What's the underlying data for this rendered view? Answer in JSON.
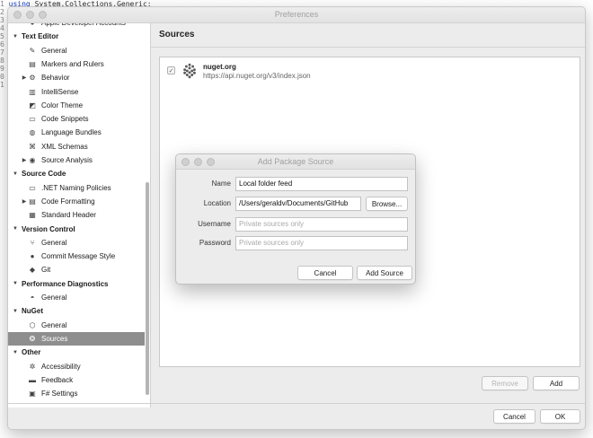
{
  "editor": {
    "lines": [
      {
        "num": "1",
        "kw": "using",
        "text": " System.Collections.Generic;"
      },
      {
        "num": "2",
        "kw": "",
        "text": ""
      },
      {
        "num": "3",
        "kw": "",
        "text": ""
      },
      {
        "num": "4",
        "kw": "",
        "text": ""
      },
      {
        "num": "5",
        "kw": "",
        "text": ""
      },
      {
        "num": "6",
        "kw": "",
        "text": ""
      },
      {
        "num": "7",
        "kw": "",
        "text": ""
      },
      {
        "num": "8",
        "kw": "",
        "text": ""
      },
      {
        "num": "9",
        "kw": "",
        "text": ""
      },
      {
        "num": "0",
        "kw": "",
        "text": ""
      },
      {
        "num": "1",
        "kw": "",
        "text": ""
      }
    ]
  },
  "window": {
    "title": "Preferences"
  },
  "sidebar": {
    "items": [
      {
        "label": "Apple Developer Accounts",
        "type": "item",
        "icon": "person-icon",
        "glyph": "●",
        "tri": ""
      },
      {
        "label": "Text Editor",
        "type": "cat",
        "icon": "",
        "glyph": "",
        "tri": "▼"
      },
      {
        "label": "General",
        "type": "item",
        "icon": "pencil-icon",
        "glyph": "✎",
        "tri": ""
      },
      {
        "label": "Markers and Rulers",
        "type": "item",
        "icon": "ruler-icon",
        "glyph": "▤",
        "tri": ""
      },
      {
        "label": "Behavior",
        "type": "item",
        "icon": "behavior-icon",
        "glyph": "⚙",
        "tri": "▶"
      },
      {
        "label": "IntelliSense",
        "type": "item",
        "icon": "intellisense-icon",
        "glyph": "▥",
        "tri": ""
      },
      {
        "label": "Color Theme",
        "type": "item",
        "icon": "palette-icon",
        "glyph": "◩",
        "tri": ""
      },
      {
        "label": "Code Snippets",
        "type": "item",
        "icon": "snippet-icon",
        "glyph": "▭",
        "tri": ""
      },
      {
        "label": "Language Bundles",
        "type": "item",
        "icon": "globe-icon",
        "glyph": "◍",
        "tri": ""
      },
      {
        "label": "XML Schemas",
        "type": "item",
        "icon": "xml-icon",
        "glyph": "⌘",
        "tri": ""
      },
      {
        "label": "Source Analysis",
        "type": "item",
        "icon": "analysis-icon",
        "glyph": "◉",
        "tri": "▶"
      },
      {
        "label": "Source Code",
        "type": "cat",
        "icon": "",
        "glyph": "",
        "tri": "▼"
      },
      {
        "label": ".NET Naming Policies",
        "type": "item",
        "icon": "naming-icon",
        "glyph": "▭",
        "tri": ""
      },
      {
        "label": "Code Formatting",
        "type": "item",
        "icon": "formatting-icon",
        "glyph": "▤",
        "tri": "▶"
      },
      {
        "label": "Standard Header",
        "type": "item",
        "icon": "header-icon",
        "glyph": "▦",
        "tri": ""
      },
      {
        "label": "Version Control",
        "type": "cat",
        "icon": "",
        "glyph": "",
        "tri": "▼"
      },
      {
        "label": "General",
        "type": "item",
        "icon": "branch-icon",
        "glyph": "⑂",
        "tri": ""
      },
      {
        "label": "Commit Message Style",
        "type": "item",
        "icon": "commit-icon",
        "glyph": "●",
        "tri": ""
      },
      {
        "label": "Git",
        "type": "item",
        "icon": "git-icon",
        "glyph": "◆",
        "tri": ""
      },
      {
        "label": "Performance Diagnostics",
        "type": "cat",
        "icon": "",
        "glyph": "",
        "tri": "▼"
      },
      {
        "label": "General",
        "type": "item",
        "icon": "gauge-icon",
        "glyph": "◓",
        "tri": ""
      },
      {
        "label": "NuGet",
        "type": "cat",
        "icon": "",
        "glyph": "",
        "tri": "▼"
      },
      {
        "label": "General",
        "type": "item",
        "icon": "package-icon",
        "glyph": "⬡",
        "tri": ""
      },
      {
        "label": "Sources",
        "type": "sel",
        "icon": "sources-icon",
        "glyph": "❂",
        "tri": ""
      },
      {
        "label": "Other",
        "type": "cat",
        "icon": "",
        "glyph": "",
        "tri": "▼"
      },
      {
        "label": "Accessibility",
        "type": "item",
        "icon": "accessibility-icon",
        "glyph": "✲",
        "tri": ""
      },
      {
        "label": "Feedback",
        "type": "item",
        "icon": "feedback-icon",
        "glyph": "▬",
        "tri": ""
      },
      {
        "label": "F# Settings",
        "type": "item",
        "icon": "fsharp-icon",
        "glyph": "▣",
        "tri": ""
      }
    ]
  },
  "pane": {
    "title": "Sources",
    "source": {
      "name": "nuget.org",
      "url": "https://api.nuget.org/v3/index.json",
      "checked": true
    },
    "remove_label": "Remove",
    "add_label": "Add"
  },
  "footer": {
    "cancel_label": "Cancel",
    "ok_label": "OK"
  },
  "dialog": {
    "title": "Add Package Source",
    "name_label": "Name",
    "name_value": "Local folder feed",
    "location_label": "Location",
    "location_value": "/Users/geraldv/Documents/GitHub",
    "browse_label": "Browse...",
    "username_label": "Username",
    "username_placeholder": "Private sources only",
    "password_label": "Password",
    "password_placeholder": "Private sources only",
    "cancel_label": "Cancel",
    "add_source_label": "Add Source"
  }
}
